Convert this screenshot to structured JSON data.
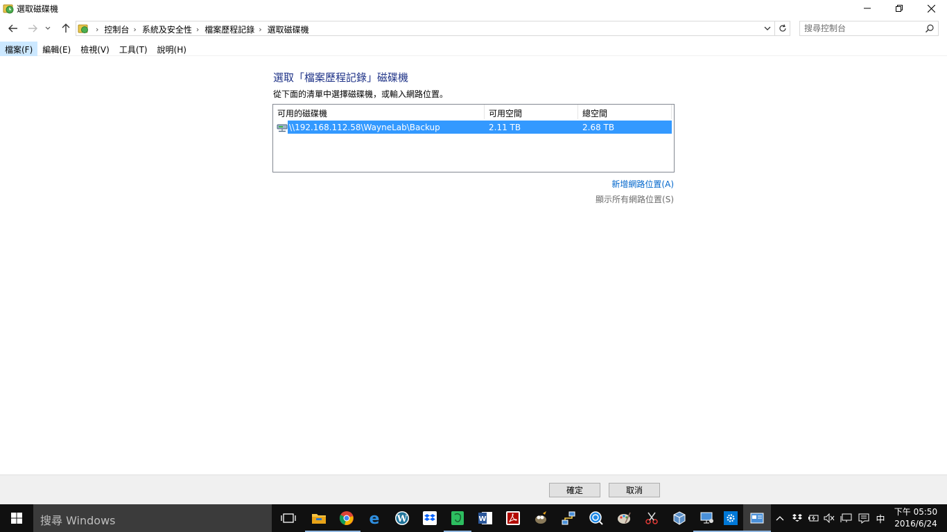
{
  "window": {
    "title": "選取磁碟機",
    "icon": "file-history-icon"
  },
  "nav": {
    "breadcrumbs": [
      "控制台",
      "系統及安全性",
      "檔案歷程記錄",
      "選取磁碟機"
    ],
    "search_placeholder": "搜尋控制台"
  },
  "menu": {
    "items": [
      "檔案(F)",
      "編輯(E)",
      "檢視(V)",
      "工具(T)",
      "說明(H)"
    ]
  },
  "main": {
    "heading": "選取「檔案歷程記錄」磁碟機",
    "instruction": "從下面的清單中選擇磁碟機，或輸入網路位置。",
    "columns": [
      "可用的磁碟機",
      "可用空間",
      "總空間"
    ],
    "drives": [
      {
        "path": "\\\\192.168.112.58\\WayneLab\\Backup",
        "free": "2.11 TB",
        "total": "2.68 TB",
        "selected": true
      }
    ],
    "add_network_link": "新增網路位置(A)",
    "show_all_link": "顯示所有網路位置(S)"
  },
  "buttons": {
    "ok": "確定",
    "cancel": "取消"
  },
  "taskbar": {
    "search_text": "搜尋 Windows",
    "apps": [
      "task-view",
      "file-explorer",
      "chrome",
      "edge",
      "wordpress",
      "dropbox",
      "evernote",
      "word",
      "acrobat",
      "gimp",
      "network-tool",
      "zoom-tool",
      "paint",
      "snip-tool",
      "virtualbox",
      "remote-desktop",
      "settings",
      "control-panel"
    ],
    "ime": "中",
    "time": "下午 05:50",
    "date": "2016/6/24"
  },
  "colors": {
    "selection": "#3399ff",
    "heading": "#1e3287",
    "link": "#0066cc",
    "menu_active": "#cce8ff"
  }
}
